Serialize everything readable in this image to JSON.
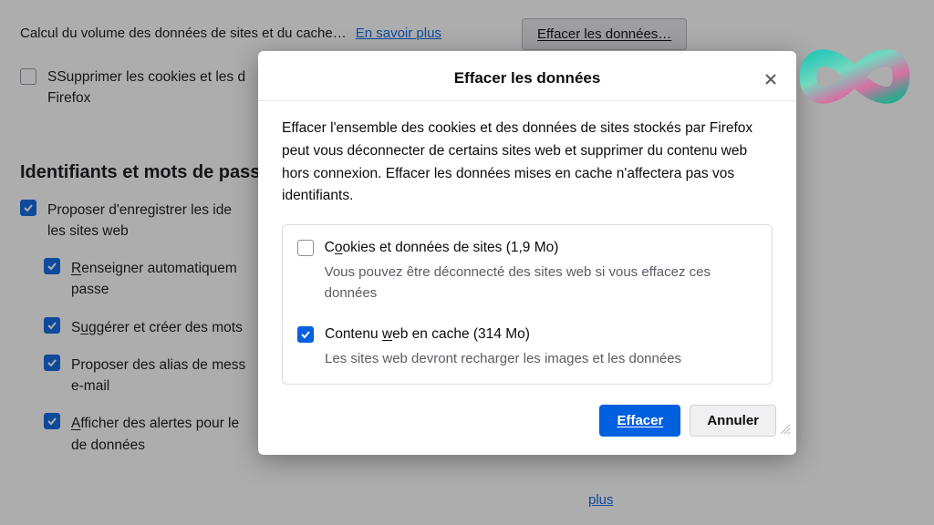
{
  "bg": {
    "volume_desc": "Calcul du volume des données de sites et du cache…",
    "learn_more": "En savoir plus",
    "clear_data_btn": "Effacer les données…",
    "delete_cookies": "Supprimer les cookies et les d",
    "delete_cookies_suffix": "Firefox",
    "section_logins": "Identifiants et mots de passe",
    "opt_save_logins_a": "Proposer d'enregistrer les ide",
    "opt_save_logins_b": "les sites web",
    "opt_autofill_a": "Renseigner automatiquem",
    "opt_autofill_b": "passe",
    "opt_suggest": "Suggérer et créer des mots",
    "opt_relay_a": "Proposer des alias de mess",
    "opt_relay_b": "e-mail",
    "opt_alerts_a": "Afficher des alertes pour le",
    "opt_alerts_b": "de données",
    "peek_link": "plus"
  },
  "dialog": {
    "title": "Effacer les données",
    "description": "Effacer l'ensemble des cookies et des données de sites stockés par Firefox peut vous déconnecter de certains sites web et supprimer du contenu web hors connexion. Effacer les données mises en cache n'affectera pas vos identifiants.",
    "item1": {
      "label_pre": "C",
      "label_u": "o",
      "label_post": "okies et données de sites (1,9 Mo)",
      "sub": "Vous pouvez être déconnecté des sites web si vous effacez ces données",
      "checked": false
    },
    "item2": {
      "label_pre": "Contenu ",
      "label_u": "w",
      "label_post": "eb en cache (314 Mo)",
      "sub": "Les sites web devront recharger les images et les données",
      "checked": true
    },
    "clear_btn": "Effacer",
    "cancel_btn": "Annuler"
  }
}
